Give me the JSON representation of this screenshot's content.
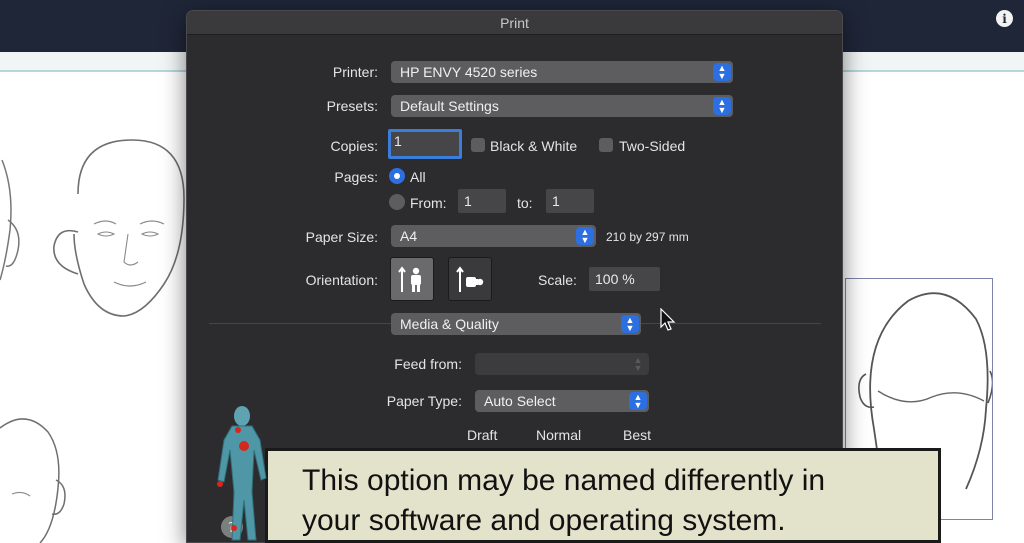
{
  "background": {
    "info_button": "i"
  },
  "dialog": {
    "title": "Print",
    "printer": {
      "label": "Printer:",
      "value": "HP ENVY 4520 series"
    },
    "presets": {
      "label": "Presets:",
      "value": "Default Settings"
    },
    "copies": {
      "label": "Copies:",
      "value": "1",
      "black_white": "Black & White",
      "two_sided": "Two-Sided"
    },
    "pages": {
      "label": "Pages:",
      "all": "All",
      "from_label": "From:",
      "from_value": "1",
      "to_label": "to:",
      "to_value": "1"
    },
    "paper_size": {
      "label": "Paper Size:",
      "value": "A4",
      "dimensions": "210 by 297 mm"
    },
    "orientation": {
      "label": "Orientation:"
    },
    "scale": {
      "label": "Scale:",
      "value": "100 %"
    },
    "section": {
      "value": "Media & Quality"
    },
    "feed_from": {
      "label": "Feed from:",
      "value": ""
    },
    "paper_type": {
      "label": "Paper Type:",
      "value": "Auto Select"
    },
    "quality": {
      "options": [
        "Draft",
        "Normal",
        "Best"
      ]
    }
  },
  "caption": {
    "line1": "This option may be named differently in",
    "line2": "your software and operating system."
  },
  "colors": {
    "accent": "#2c6fe0",
    "dialog_bg": "#2c2c2e",
    "caption_bg": "#e3e2cb"
  }
}
